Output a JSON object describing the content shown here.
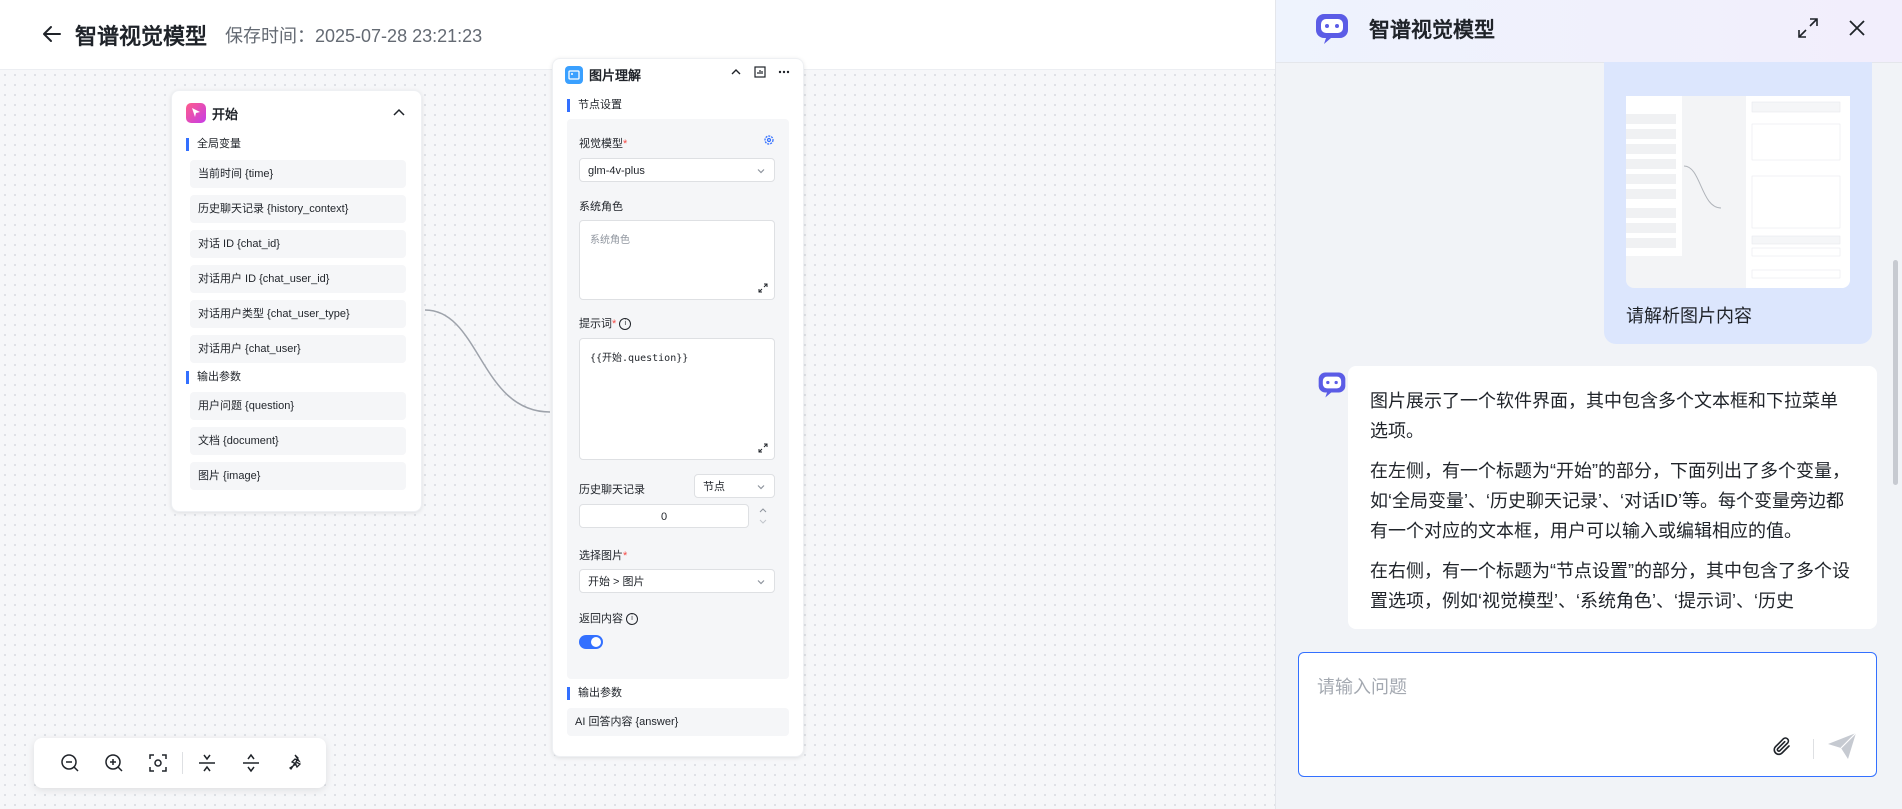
{
  "header": {
    "title": "智谱视觉模型",
    "save_time": "保存时间：2025-07-28 23:21:23"
  },
  "start_node": {
    "title": "开始",
    "global_section": "全局变量",
    "global_vars": [
      "当前时间 {time}",
      "历史聊天记录 {history_context}",
      "对话 ID {chat_id}",
      "对话用户 ID {chat_user_id}",
      "对话用户类型 {chat_user_type}",
      "对话用户 {chat_user}"
    ],
    "output_section": "输出参数",
    "output_vars": [
      "用户问题 {question}",
      "文档 {document}",
      "图片 {image}"
    ]
  },
  "image_node": {
    "title": "图片理解",
    "settings_section": "节点设置",
    "model_label": "视觉模型",
    "model_value": "glm-4v-plus",
    "system_role_label": "系统角色",
    "system_role_placeholder": "系统角色",
    "prompt_label": "提示词",
    "prompt_value": "{{开始.question}}",
    "history_label": "历史聊天记录",
    "history_select": "节点",
    "history_count": "0",
    "image_label": "选择图片",
    "image_value": "开始 > 图片",
    "return_label": "返回内容",
    "return_enabled": true,
    "output_section": "输出参数",
    "output_var": "AI 回答内容 {answer}"
  },
  "chat": {
    "title": "智谱视觉模型",
    "user_message": "请解析图片内容",
    "answer_paragraphs": [
      "图片展示了一个软件界面，其中包含多个文本框和下拉菜单选项。",
      "在左侧，有一个标题为“开始”的部分，下面列出了多个变量，如‘全局变量’、‘历史聊天记录’、‘对话ID’等。每个变量旁边都有一个对应的文本框，用户可以输入或编辑相应的值。",
      "在右侧，有一个标题为“节点设置”的部分，其中包含了多个设置选项，例如‘视觉模型’、‘系统角色’、‘提示词’、‘历史"
    ],
    "input_placeholder": "请输入问题"
  },
  "colors": {
    "accent": "#3370ff",
    "user_bubble": "#dce6fd"
  }
}
